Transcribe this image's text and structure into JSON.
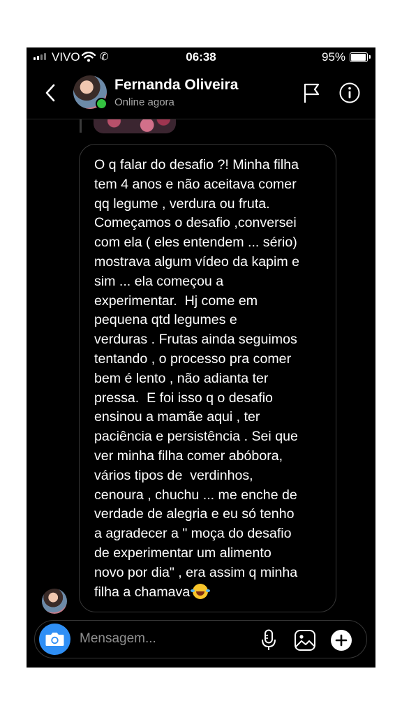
{
  "status_bar": {
    "carrier": "VIVO",
    "time": "06:38",
    "battery_percent": "95%",
    "battery_level": 0.95
  },
  "header": {
    "contact_name": "Fernanda Oliveira",
    "status": "Online agora",
    "icons": [
      "chevron-left-icon",
      "flag-icon",
      "info-icon"
    ]
  },
  "conversation": {
    "message": "O q falar do desafio ?! Minha filha\ntem 4 anos e não aceitava comer\nqq legume , verdura ou fruta.\nComeçamos o desafio ,conversei\ncom ela ( eles entendem ... sério)\nmostrava algum vídeo da kapim e\nsim ... ela começou a\nexperimentar.  Hj come em\npequena qtd legumes e\nverduras . Frutas ainda seguimos\ntentando , o processo pra comer\nbem é lento , não adianta ter\npressa.  E foi isso q o desafio\nensinou a mamãe aqui , ter\npaciência e persistência . Sei que\nver minha filha comer abóbora,\nvários tipos de  verdinhos,\ncenoura , chuchu ... me enche de\nverdade de alegria e eu só tenho\na agradecer a \" moça do desafio\nde experimentar um alimento\nnovo por dia\" , era assim q minha\nfilha a chamava",
    "message_emoji": "laughing-tears-emoji"
  },
  "composer": {
    "placeholder": "Mensagem...",
    "icons": [
      "camera-icon",
      "microphone-icon",
      "gallery-icon",
      "plus-icon"
    ]
  },
  "colors": {
    "background": "#000000",
    "online_dot": "#34c240",
    "camera_button": "#2f8ff5",
    "secondary_text": "#a8a8a8"
  }
}
